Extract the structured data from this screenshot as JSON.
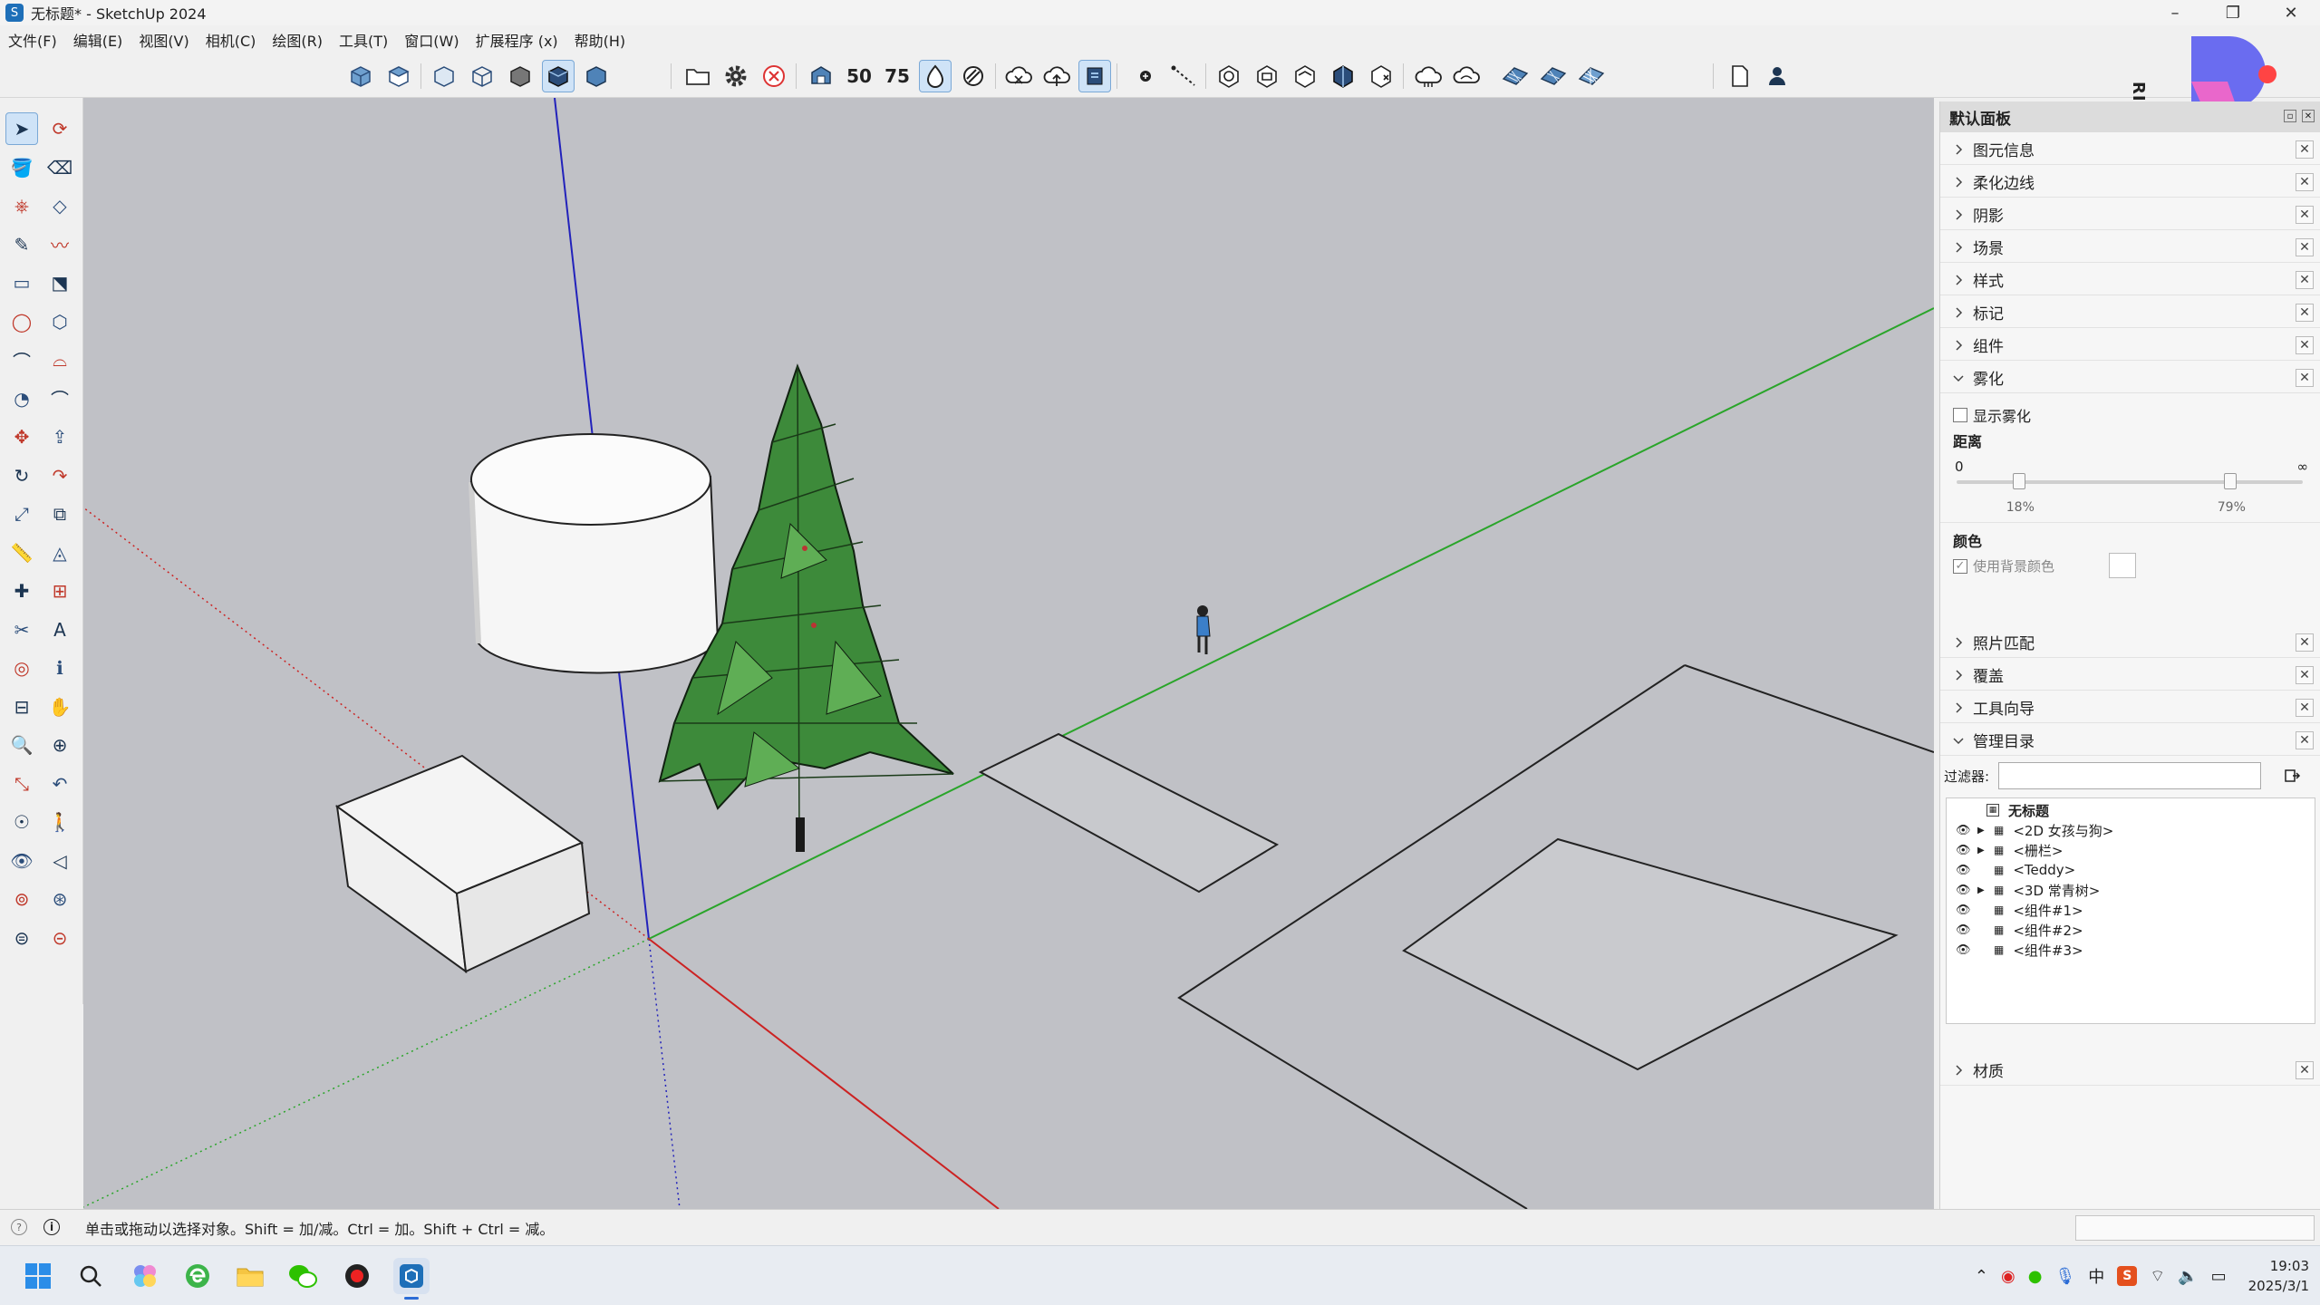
{
  "window": {
    "title": "无标题* - SketchUp 2024",
    "icon": "sketchup-icon",
    "controls": [
      "minimize-icon",
      "maximize-icon",
      "close-icon"
    ]
  },
  "menu": [
    "文件(F)",
    "编辑(E)",
    "视图(V)",
    "相机(C)",
    "绘图(R)",
    "工具(T)",
    "窗口(W)",
    "扩展程序 (x)",
    "帮助(H)"
  ],
  "toolbar": {
    "view_icons": [
      "iso-view-icon",
      "top-view-icon",
      "front-view-icon",
      "right-view-icon",
      "back-view-icon",
      "left-view-icon"
    ],
    "style_icons": [
      "xray-style-icon",
      "wireframe-style-icon",
      "hidden-line-style-icon",
      "shaded-style-icon",
      "shaded-texture-style-icon",
      "monochrome-style-icon"
    ],
    "file_icons": [
      "open-folder-icon",
      "settings-gear-icon",
      "cancel-icon"
    ],
    "sandbox_icons": [
      "warehouse-icon",
      "extension-50-icon",
      "extension-75-icon",
      "solid-inspector-icon",
      "section-fill-icon"
    ],
    "cloud_icons": [
      "cloud-sync-icon",
      "cloud-upload-icon",
      "layout-send-icon"
    ],
    "dot_icons": [
      "point-icon",
      "dashed-line-icon"
    ],
    "geometry_icons": [
      "solid-outer-shell-icon",
      "solid-intersect-icon",
      "solid-union-icon",
      "solid-subtract-icon",
      "solid-trim-icon"
    ],
    "more_icons": [
      "cloud-a-icon",
      "cloud-b-icon",
      "sandbox-grid-a-icon",
      "sandbox-grid-b-icon",
      "sandbox-grid-c-icon"
    ],
    "right_icons": [
      "new-file-icon",
      "user-account-icon"
    ]
  },
  "tools": [
    "select-icon",
    "lasso-select-icon",
    "paint-bucket-icon",
    "eraser-icon",
    "tag-tool-icon",
    "eraser-alt-icon",
    "pencil-line-icon",
    "freehand-icon",
    "rectangle-icon",
    "rotated-rectangle-icon",
    "circle-icon",
    "polygon-icon",
    "arc-icon",
    "two-point-arc-icon",
    "pie-icon",
    "three-point-arc-icon",
    "move-icon",
    "push-pull-icon",
    "rotate-icon",
    "follow-me-icon",
    "scale-icon",
    "offset-icon",
    "tape-measure-icon",
    "protractor-icon",
    "axes-icon",
    "dimension-icon",
    "section-plane-icon",
    "3d-text-icon",
    "orbit-icon",
    "text-label-icon",
    "section-fill-tool-icon",
    "pan-walk-icon",
    "zoom-icon",
    "zoom-window-icon",
    "zoom-extents-icon",
    "previous-view-icon",
    "position-camera-icon",
    "walk-icon",
    "look-around-icon",
    "look-sound-icon",
    "sandbox-smoove-icon",
    "sandbox-stamp-icon",
    "sandbox-drape-icon",
    "sandbox-flip-icon"
  ],
  "panel": {
    "title": "默认面板",
    "trays_top": [
      "图元信息",
      "柔化边线",
      "阴影",
      "场景",
      "样式",
      "标记",
      "组件"
    ],
    "fog": {
      "label": "雾化",
      "show_fog": "显示雾化",
      "show_fog_checked": false,
      "distance_label": "距离",
      "distance_min": "0",
      "distance_max": "∞",
      "start_percent": "18%",
      "end_percent": "79%",
      "start_value": 0.18,
      "end_value": 0.79,
      "color_label": "颜色",
      "use_bg_color": "使用背景颜色",
      "use_bg_color_checked": true
    },
    "trays_bottom": [
      "照片匹配",
      "覆盖",
      "工具向导"
    ],
    "outliner": {
      "label": "管理目录",
      "filter_label": "过滤器:",
      "filter_value": "",
      "root": "无标题",
      "items": [
        {
          "name": "<2D 女孩与狗>",
          "expandable": true
        },
        {
          "name": "<栅栏>",
          "expandable": true
        },
        {
          "name": "<Teddy>",
          "expandable": false
        },
        {
          "name": "<3D 常青树>",
          "expandable": true
        },
        {
          "name": "<组件#1>",
          "expandable": false
        },
        {
          "name": "<组件#2>",
          "expandable": false
        },
        {
          "name": "<组件#3>",
          "expandable": false
        }
      ]
    },
    "materials": "材质"
  },
  "status": {
    "text": "单击或拖动以选择对象。Shift = 加/减。Ctrl = 加。Shift + Ctrl = 减。",
    "measurements": ""
  },
  "watermark": "RING-Studio",
  "taskbar": {
    "icons": [
      "windows-start-icon",
      "search-icon",
      "widgets-icon",
      "browser-icon",
      "file-explorer-icon",
      "wechat-icon",
      "recorder-icon",
      "sketchup-task-icon"
    ],
    "systray": [
      "chevron-up-icon",
      "record-icon",
      "wechat-tray-icon",
      "microphone-icon"
    ],
    "ime": "中",
    "systray_right": [
      "app-s-icon",
      "wifi-icon",
      "volume-icon",
      "battery-icon"
    ],
    "time": "19:03",
    "date": "2025/3/1"
  },
  "colors": {
    "viewport_bg": "#c0c1c6",
    "axis_red": "#cc2222",
    "axis_green": "#2aa52a",
    "axis_blue": "#2222bb",
    "tree_green": "#3d8a3a",
    "accent": "#2b6cd6"
  }
}
